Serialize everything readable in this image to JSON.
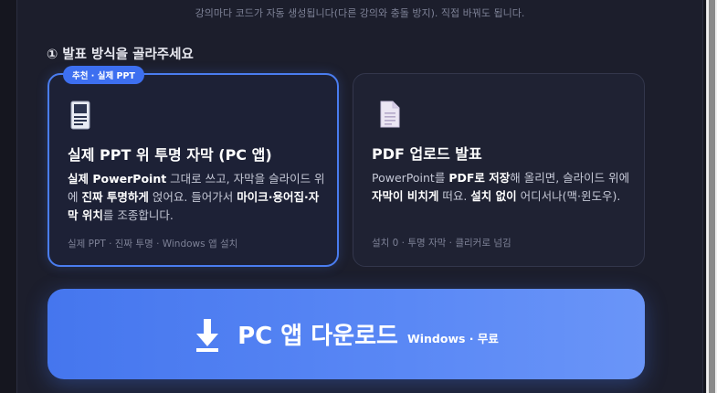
{
  "helper_text": "강의마다 코드가 자동 생성됩니다(다른 강의와 충돌 방지). 직접 바꿔도 됩니다.",
  "section_title": "① 발표 방식을 골라주세요",
  "cards": [
    {
      "badge": "추천 · 실제 PPT",
      "icon": "slide-document-icon",
      "title": "실제 PPT 위 투명 자막 (PC 앱)",
      "desc": [
        {
          "t": "실제 PowerPoint",
          "b": true
        },
        {
          "t": " 그대로 쓰고, 자막을 슬라이드 위에 ",
          "b": false
        },
        {
          "t": "진짜 투명하게",
          "b": true
        },
        {
          "t": " 얹어요. 들어가서 ",
          "b": false
        },
        {
          "t": "마이크·용어집·자막 위치",
          "b": true
        },
        {
          "t": "를 조종합니다.",
          "b": false
        }
      ],
      "meta": "실제 PPT · 진짜 투명 · Windows 앱 설치"
    },
    {
      "icon": "pdf-document-icon",
      "title": "PDF 업로드 발표",
      "desc": [
        {
          "t": "PowerPoint를 ",
          "b": false
        },
        {
          "t": "PDF로 저장",
          "b": true
        },
        {
          "t": "해 올리면, 슬라이드 위에 ",
          "b": false
        },
        {
          "t": "자막이 비치게",
          "b": true
        },
        {
          "t": " 떠요. ",
          "b": false
        },
        {
          "t": "설치 없이",
          "b": true
        },
        {
          "t": " 어디서나(맥·윈도우).",
          "b": false
        }
      ],
      "meta": "설치 0 · 투명 자막 · 클리커로 넘김"
    }
  ],
  "download": {
    "icon": "download-arrow-icon",
    "label": "PC 앱 다운로드",
    "sub": "Windows · 무료"
  },
  "colors": {
    "accent": "#4a7df0",
    "panel": "#1c1e2c",
    "background": "#15161f"
  }
}
